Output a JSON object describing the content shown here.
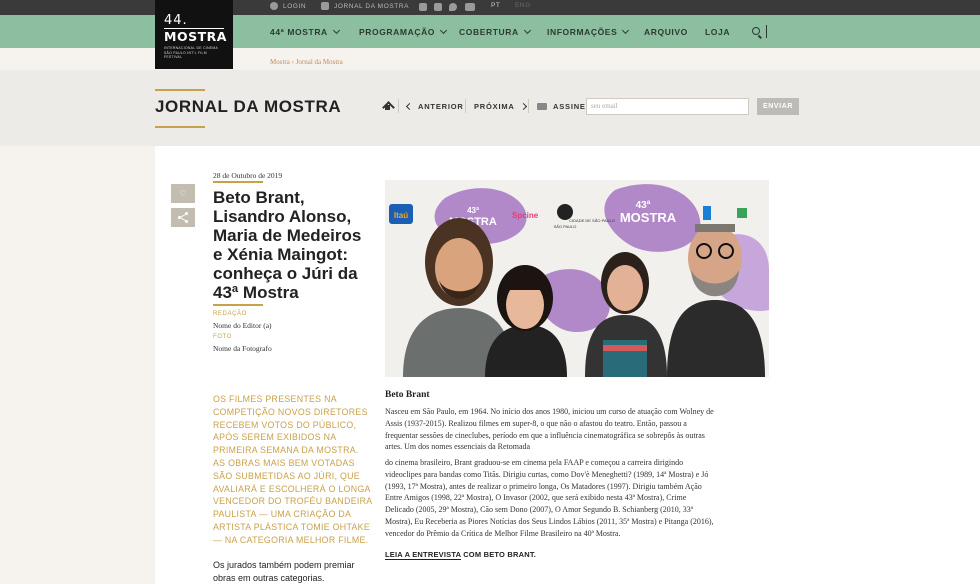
{
  "topbar": {
    "login": "LOGIN",
    "journal": "JORNAL DA MOSTRA",
    "lang_pt": "PT",
    "lang_eng": "ENG",
    "social": [
      "facebook-icon",
      "instagram-icon",
      "twitter-icon",
      "youtube-icon"
    ]
  },
  "logo": {
    "number": "44.",
    "brand": "MOSTRA",
    "subtitle": "INTERNACIONAL DE CINEMA SÃO PAULO INT'L FILM FESTIVAL"
  },
  "nav": {
    "items": [
      {
        "label": "44ª MOSTRA",
        "dropdown": true
      },
      {
        "label": "PROGRAMAÇÃO",
        "dropdown": true
      },
      {
        "label": "COBERTURA",
        "dropdown": true
      },
      {
        "label": "INFORMAÇÕES",
        "dropdown": true
      },
      {
        "label": "ARQUIVO",
        "dropdown": false
      },
      {
        "label": "LOJA",
        "dropdown": false
      }
    ]
  },
  "breadcrumb": "Mostra › Jornal da Mostra",
  "page_title": "JORNAL DA MOSTRA",
  "toolbar": {
    "prev_label": "ANTERIOR",
    "next_label": "PRÓXIMA",
    "subscribe_label": "ASSINE",
    "email_placeholder": "seu email",
    "send_label": "ENVIAR"
  },
  "article": {
    "date": "28 de Outubro de 2019",
    "title": "Beto Brant, Lisandro Alonso, Maria de Medeiros e Xénia Maingot: conheça o Júri da 43ª Mostra",
    "editor_label": "REDAÇÃO",
    "editor_name": "Nome do Editor (a)",
    "photo_label": "FOTO",
    "photo_name": "Nome da Fotografo",
    "lead": "OS FILMES PRESENTES NA COMPETIÇÃO NOVOS DIRETORES RECEBEM VOTOS DO PÚBLICO, APÓS SEREM EXIBIDOS NA PRIMEIRA SEMANA DA MOSTRA. AS OBRAS MAIS BEM VOTADAS SÃO SUBMETIDAS AO JÚRI, QUE AVALIARÁ E ESCOLHERÁ O LONGA VENCEDOR DO TROFÉU BANDEIRA PAULISTA — UMA CRIAÇÃO DA ARTISTA PLÁSTICA TOMIE OHTAKE— NA CATEGORIA MELHOR FILME.",
    "lead_2": "Os jurados também podem premiar obras em outras categorias.",
    "photo_texts": {
      "sponsor": "Itaú",
      "mostra_num": "43ª",
      "mostra_word": "MOSTRA",
      "mostra_sub": "INTERNACIONAL DE CINEMA • SÃO PAULO INT'L FILM FESTIVAL",
      "spcine": "Spcine",
      "sao_paulo": "SÃO PAULO",
      "cidade": "CIDADE DE SÃO PAULO"
    },
    "section_head": "Beto Brant",
    "paragraph_1": "Nasceu em São Paulo, em 1964. No início dos anos 1980, iniciou um curso de atuação com Wolney de Assis (1937-2015). Realizou filmes em super-8, o que não o afastou do teatro. Então, passou a frequentar sessões de cineclubes, período em que a influência cinematográfica se sobrepôs às outras artes. Um dos nomes essenciais da Retomada",
    "paragraph_2": "do cinema brasileiro, Brant graduou-se em cinema pela FAAP e começou a carreira dirigindo videoclipes para bandas como Titãs. Dirigiu curtas, como Dov'è Meneghetti? (1989, 14ª Mostra) e Jó (1993, 17ª Mostra), antes de realizar o primeiro longa, Os Matadores (1997). Dirigiu também Ação Entre Amigos (1998, 22ª Mostra), O Invasor (2002, que será exibido nesta 43ª Mostra), Crime Delicado (2005, 29ª Mostra), Cão sem Dono (2007), O Amor Segundo B. Schianberg (2010, 33ª Mostra), Eu Receberia as Piores Notícias dos Seus Lindos Lábios (2011, 35ª Mostra) e Pitanga (2016), vencedor do Prêmio da Crítica de Melhor Filme Brasileiro na 40ª Mostra.",
    "read_more_link": "LEIA A ENTREVISTA",
    "read_more_rest": " COM BETO BRANT."
  },
  "colors": {
    "nav_green": "#8bbf9f",
    "accent_gold": "#c9a14a",
    "topbar_dark": "#3a3a3a",
    "backdrop_purple": "#b189c9"
  }
}
